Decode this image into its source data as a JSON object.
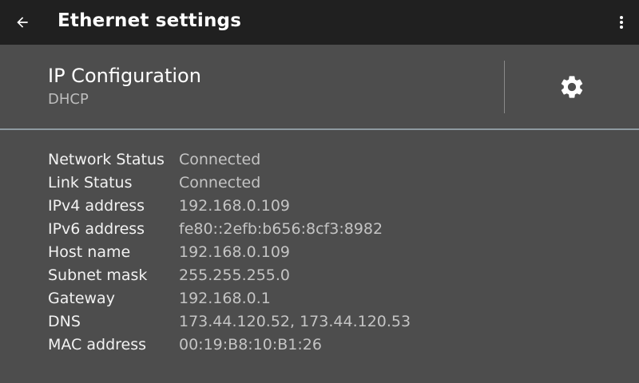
{
  "toolbar": {
    "title": "Ethernet settings",
    "back_icon": "arrow-left-icon",
    "overflow_icon": "more-vert-icon"
  },
  "ip_configuration": {
    "title": "IP Configuration",
    "mode": "DHCP",
    "settings_icon": "gear-icon"
  },
  "details": [
    {
      "label": "Network Status",
      "value": "Connected"
    },
    {
      "label": "Link Status",
      "value": "Connected"
    },
    {
      "label": "IPv4 address",
      "value": "192.168.0.109"
    },
    {
      "label": "IPv6 address",
      "value": "fe80::2efb:b656:8cf3:8982"
    },
    {
      "label": "Host name",
      "value": "192.168.0.109"
    },
    {
      "label": "Subnet mask",
      "value": "255.255.255.0"
    },
    {
      "label": "Gateway",
      "value": "192.168.0.1"
    },
    {
      "label": "DNS",
      "value": "173.44.120.52, 173.44.120.53"
    },
    {
      "label": "MAC address",
      "value": "00:19:B8:10:B1:26"
    }
  ],
  "colors": {
    "toolbar_bg": "#202020",
    "content_bg": "#4d4d4d",
    "divider": "#8e9aa0"
  }
}
